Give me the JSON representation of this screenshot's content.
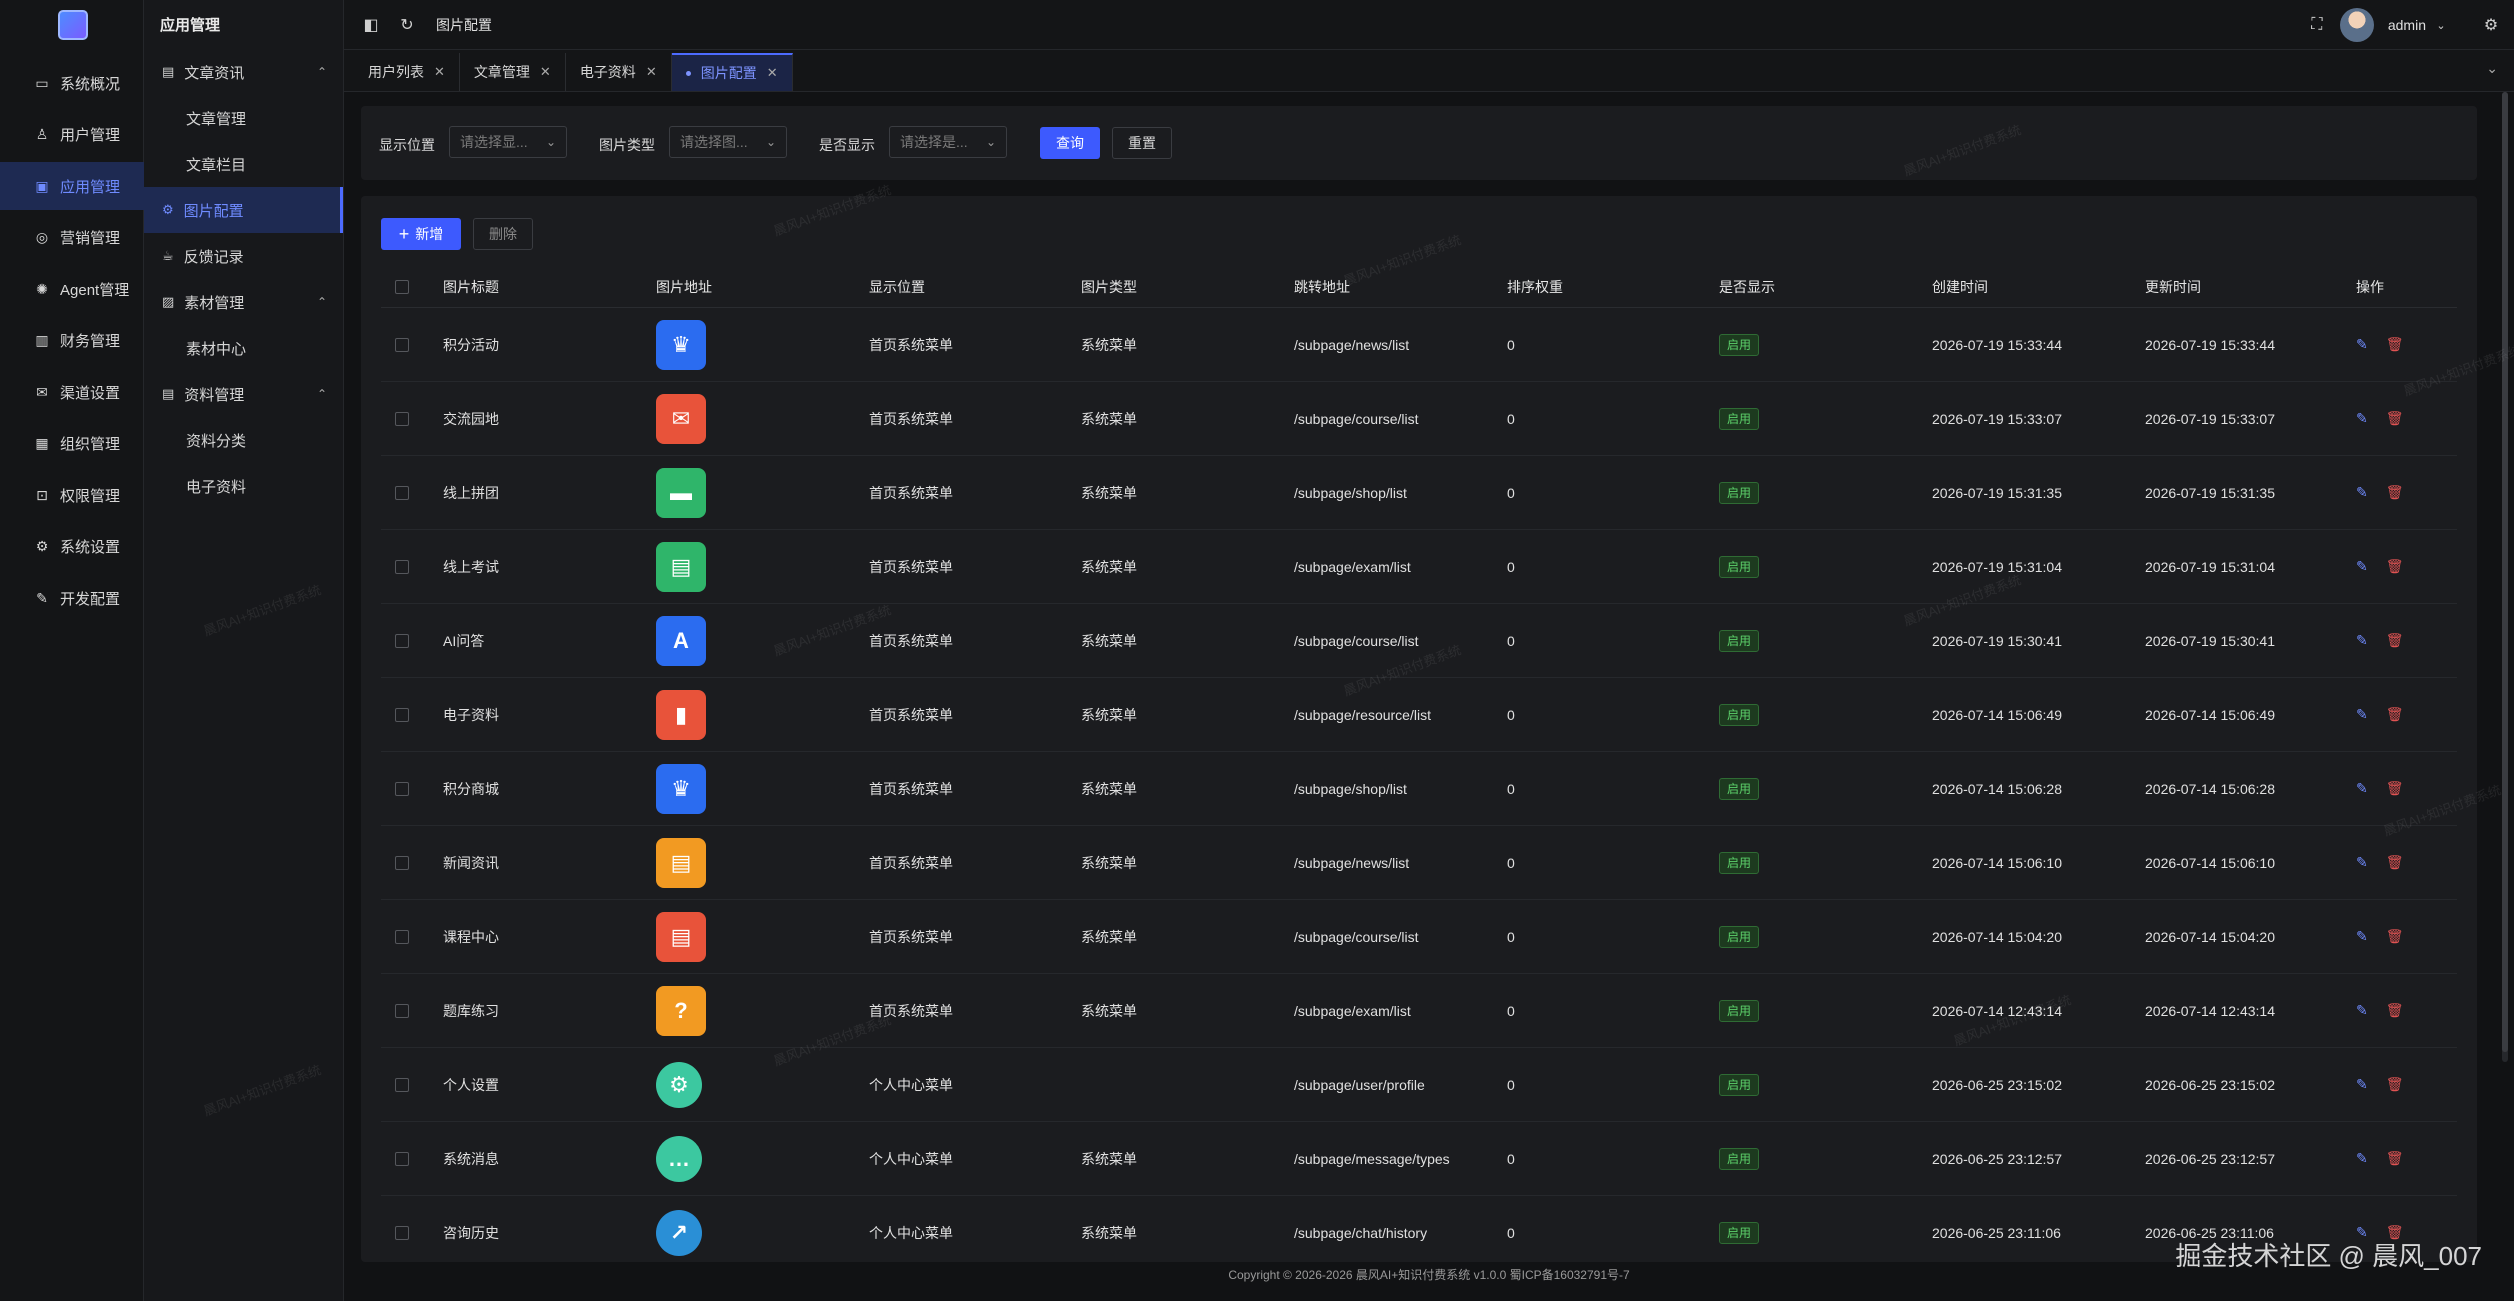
{
  "rail": {
    "items": [
      {
        "label": "系统概况",
        "icon": "monitor-icon"
      },
      {
        "label": "用户管理",
        "icon": "user-icon"
      },
      {
        "label": "应用管理",
        "icon": "app-icon"
      },
      {
        "label": "营销管理",
        "icon": "marketing-icon"
      },
      {
        "label": "Agent管理",
        "icon": "agent-icon"
      },
      {
        "label": "财务管理",
        "icon": "finance-icon"
      },
      {
        "label": "渠道设置",
        "icon": "mail-icon"
      },
      {
        "label": "组织管理",
        "icon": "org-icon"
      },
      {
        "label": "权限管理",
        "icon": "lock-icon"
      },
      {
        "label": "系统设置",
        "icon": "gear-icon"
      },
      {
        "label": "开发配置",
        "icon": "edit-icon"
      }
    ]
  },
  "sub": {
    "title": "应用管理",
    "items": [
      {
        "label": "文章资讯"
      },
      {
        "label": "文章管理"
      },
      {
        "label": "文章栏目"
      },
      {
        "label": "图片配置"
      },
      {
        "label": "反馈记录"
      },
      {
        "label": "素材管理"
      },
      {
        "label": "素材中心"
      },
      {
        "label": "资料管理"
      },
      {
        "label": "资料分类"
      },
      {
        "label": "电子资料"
      }
    ]
  },
  "topbar": {
    "breadcrumb": "图片配置",
    "user": "admin"
  },
  "tabs": [
    {
      "label": "用户列表"
    },
    {
      "label": "文章管理"
    },
    {
      "label": "电子资料"
    },
    {
      "label": "图片配置"
    }
  ],
  "search": {
    "position_label": "显示位置",
    "position_placeholder": "请选择显...",
    "type_label": "图片类型",
    "type_placeholder": "请选择图...",
    "show_label": "是否显示",
    "show_placeholder": "请选择是...",
    "query_button": "查询",
    "reset_button": "重置"
  },
  "toolbar": {
    "add_button": "新增",
    "delete_button": "删除"
  },
  "table": {
    "headers": [
      "图片标题",
      "图片地址",
      "显示位置",
      "图片类型",
      "跳转地址",
      "排序权重",
      "是否显示",
      "创建时间",
      "更新时间",
      "操作"
    ],
    "rows": [
      {
        "title": "积分活动",
        "color": "#2b6cf0",
        "glyph": "♛",
        "round": false,
        "position": "首页系统菜单",
        "type": "系统菜单",
        "url": "/subpage/news/list",
        "weight": "0",
        "show": "启用",
        "created": "2026-07-19 15:33:44",
        "updated": "2026-07-19 15:33:44"
      },
      {
        "title": "交流园地",
        "color": "#e8533a",
        "glyph": "✉",
        "round": false,
        "position": "首页系统菜单",
        "type": "系统菜单",
        "url": "/subpage/course/list",
        "weight": "0",
        "show": "启用",
        "created": "2026-07-19 15:33:07",
        "updated": "2026-07-19 15:33:07"
      },
      {
        "title": "线上拼团",
        "color": "#2fb56a",
        "glyph": "▬",
        "round": false,
        "position": "首页系统菜单",
        "type": "系统菜单",
        "url": "/subpage/shop/list",
        "weight": "0",
        "show": "启用",
        "created": "2026-07-19 15:31:35",
        "updated": "2026-07-19 15:31:35"
      },
      {
        "title": "线上考试",
        "color": "#2fb56a",
        "glyph": "▤",
        "round": false,
        "position": "首页系统菜单",
        "type": "系统菜单",
        "url": "/subpage/exam/list",
        "weight": "0",
        "show": "启用",
        "created": "2026-07-19 15:31:04",
        "updated": "2026-07-19 15:31:04"
      },
      {
        "title": "AI问答",
        "color": "#2b6cf0",
        "glyph": "A",
        "round": false,
        "position": "首页系统菜单",
        "type": "系统菜单",
        "url": "/subpage/course/list",
        "weight": "0",
        "show": "启用",
        "created": "2026-07-19 15:30:41",
        "updated": "2026-07-19 15:30:41"
      },
      {
        "title": "电子资料",
        "color": "#e8533a",
        "glyph": "▮",
        "round": false,
        "position": "首页系统菜单",
        "type": "系统菜单",
        "url": "/subpage/resource/list",
        "weight": "0",
        "show": "启用",
        "created": "2026-07-14 15:06:49",
        "updated": "2026-07-14 15:06:49"
      },
      {
        "title": "积分商城",
        "color": "#2b6cf0",
        "glyph": "♛",
        "round": false,
        "position": "首页系统菜单",
        "type": "系统菜单",
        "url": "/subpage/shop/list",
        "weight": "0",
        "show": "启用",
        "created": "2026-07-14 15:06:28",
        "updated": "2026-07-14 15:06:28"
      },
      {
        "title": "新闻资讯",
        "color": "#f29a22",
        "glyph": "▤",
        "round": false,
        "position": "首页系统菜单",
        "type": "系统菜单",
        "url": "/subpage/news/list",
        "weight": "0",
        "show": "启用",
        "created": "2026-07-14 15:06:10",
        "updated": "2026-07-14 15:06:10"
      },
      {
        "title": "课程中心",
        "color": "#e8533a",
        "glyph": "▤",
        "round": false,
        "position": "首页系统菜单",
        "type": "系统菜单",
        "url": "/subpage/course/list",
        "weight": "0",
        "show": "启用",
        "created": "2026-07-14 15:04:20",
        "updated": "2026-07-14 15:04:20"
      },
      {
        "title": "题库练习",
        "color": "#f29a22",
        "glyph": "?",
        "round": false,
        "position": "首页系统菜单",
        "type": "系统菜单",
        "url": "/subpage/exam/list",
        "weight": "0",
        "show": "启用",
        "created": "2026-07-14 12:43:14",
        "updated": "2026-07-14 12:43:14"
      },
      {
        "title": "个人设置",
        "color": "#3cc8a0",
        "glyph": "⚙",
        "round": true,
        "position": "个人中心菜单",
        "type": "",
        "url": "/subpage/user/profile",
        "weight": "0",
        "show": "启用",
        "created": "2026-06-25 23:15:02",
        "updated": "2026-06-25 23:15:02"
      },
      {
        "title": "系统消息",
        "color": "#3cc8a0",
        "glyph": "…",
        "round": true,
        "position": "个人中心菜单",
        "type": "系统菜单",
        "url": "/subpage/message/types",
        "weight": "0",
        "show": "启用",
        "created": "2026-06-25 23:12:57",
        "updated": "2026-06-25 23:12:57"
      },
      {
        "title": "咨询历史",
        "color": "#2a8fd6",
        "glyph": "↗",
        "round": true,
        "position": "个人中心菜单",
        "type": "系统菜单",
        "url": "/subpage/chat/history",
        "weight": "0",
        "show": "启用",
        "created": "2026-06-25 23:11:06",
        "updated": "2026-06-25 23:11:06"
      }
    ]
  },
  "footer": "Copyright © 2026-2026 晨风AI+知识付费系统 v1.0.0 蜀ICP备16032791号-7",
  "brand_watermark": "掘金技术社区 @ 晨风_007",
  "bg_watermark": "晨风AI+知识付费系统",
  "colors": {
    "accent": "#3d5afe",
    "active_bg": "#1e2a52",
    "success": "#5cd06a",
    "danger": "#e05353"
  }
}
